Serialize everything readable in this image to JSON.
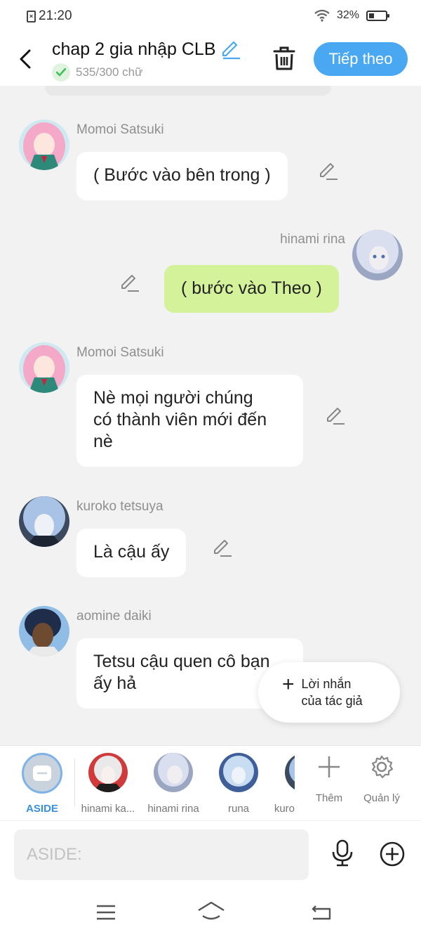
{
  "status": {
    "time": "21:20",
    "battery": "32%"
  },
  "header": {
    "title": "chap 2 gia nhập CLB",
    "word_count": "535/300 chữ",
    "next_label": "Tiếp theo"
  },
  "messages": [
    {
      "name": "Momoi Satsuki",
      "text": "( Bước vào bên trong )"
    },
    {
      "name": "hinami rina",
      "text": "( bước vào Theo )"
    },
    {
      "name": "Momoi Satsuki",
      "line1": "Nè mọi người chúng",
      "line2": "có thành viên mới đến",
      "line3": "nè"
    },
    {
      "name": "kuroko tetsuya",
      "text": "Là cậu ấy"
    },
    {
      "name": "aomine daiki",
      "line1": "Tetsu cậu quen cô bạn",
      "line2": "ấy hả"
    }
  ],
  "author_note": {
    "line1": "Lời nhắn",
    "line2": "của tác giả"
  },
  "characters": [
    {
      "label": "ASIDE"
    },
    {
      "label": "hinami ka..."
    },
    {
      "label": "hinami rina"
    },
    {
      "label": "runa"
    },
    {
      "label": "kuro"
    }
  ],
  "tools": {
    "add": "Thêm",
    "manage": "Quản lý"
  },
  "input": {
    "placeholder": "ASIDE:"
  },
  "colors": {
    "accent": "#4aa8f2",
    "my_bubble": "#d4f29a",
    "background": "#f2f2f2"
  }
}
